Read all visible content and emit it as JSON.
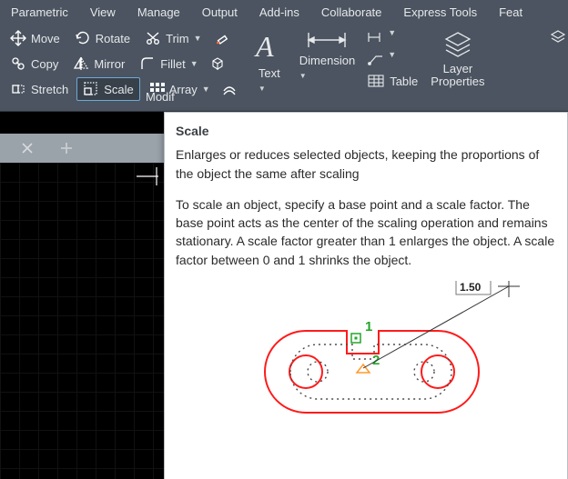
{
  "menu": {
    "items": [
      "Parametric",
      "View",
      "Manage",
      "Output",
      "Add-ins",
      "Collaborate",
      "Express Tools",
      "Feat"
    ]
  },
  "ribbon": {
    "modify": {
      "move": "Move",
      "rotate": "Rotate",
      "trim": "Trim",
      "copy": "Copy",
      "mirror": "Mirror",
      "fillet": "Fillet",
      "stretch": "Stretch",
      "scale": "Scale",
      "array": "Array",
      "title": "Modif"
    },
    "annot": {
      "text": "Text",
      "dimension": "Dimension",
      "table": "Table"
    },
    "layers": {
      "props": "Layer\nProperties"
    }
  },
  "tooltip": {
    "title": "Scale",
    "p1": "Enlarges or reduces selected objects, keeping the proportions of the object the same after scaling",
    "p2": "To scale an object, specify a base point and a scale factor. The base point acts as the center of the scaling operation and remains stationary. A scale factor greater than 1 enlarges the object. A scale factor between 0 and 1 shrinks the object.",
    "callout1": "1",
    "callout2": "2",
    "factor": "1.50"
  },
  "colors": {
    "accent": "#6fa8d6"
  }
}
